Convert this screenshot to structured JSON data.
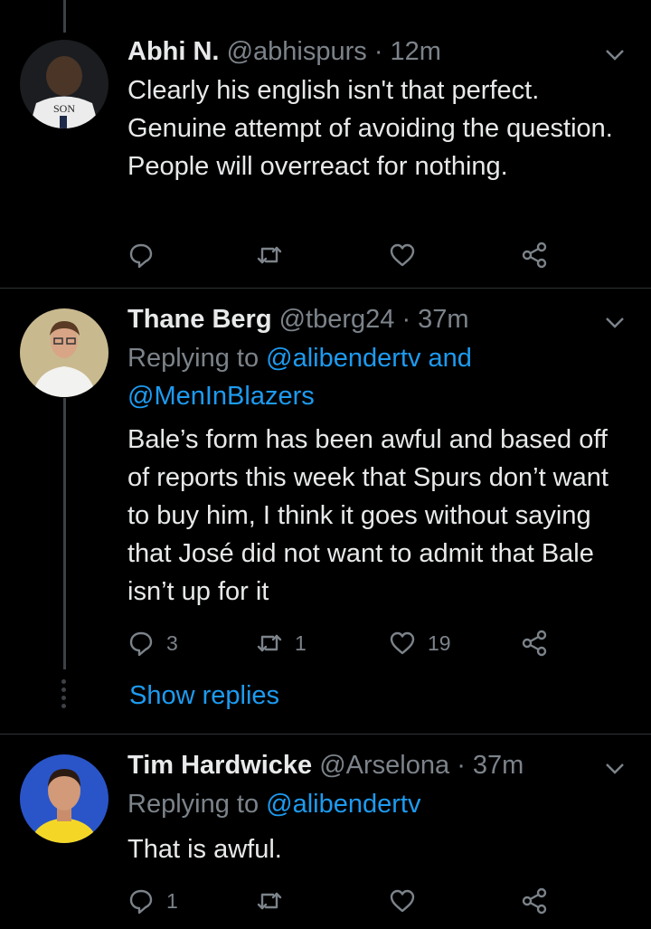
{
  "tweets": [
    {
      "name": "Abhi N.",
      "handle": "@abhispurs",
      "time": "· 12m",
      "avatar_text": "SON",
      "text": "Clearly his english isn't that perfect. Genuine attempt of avoiding the question. People will overreact for nothing.",
      "replies": "",
      "retweets": "",
      "likes": ""
    },
    {
      "name": "Thane Berg",
      "handle": "@tberg24",
      "time": "· 37m",
      "replying_prefix": "Replying to",
      "replying_to_1": "@alibendertv",
      "replying_and": "and",
      "replying_to_2": "@MenInBlazers",
      "text": "Bale’s form has been awful and based off of reports this week that Spurs don’t want to buy him, I think it goes without saying that José did not want to admit that Bale isn’t up for it",
      "replies": "3",
      "retweets": "1",
      "likes": "19",
      "show_replies": "Show replies"
    },
    {
      "name": "Tim Hardwicke",
      "handle": "@Arselona",
      "time": "· 37m",
      "replying_prefix": "Replying to",
      "replying_to_1": "@alibendertv",
      "text": "That is awful.",
      "replies": "1",
      "retweets": "",
      "likes": ""
    }
  ],
  "colors": {
    "background": "#000000",
    "text": "#e7e9ea",
    "secondary": "#7c838a",
    "link": "#1d9bf0",
    "divider": "#2f3336"
  },
  "icons": [
    "reply-icon",
    "retweet-icon",
    "like-icon",
    "share-icon",
    "chevron-down-icon"
  ]
}
